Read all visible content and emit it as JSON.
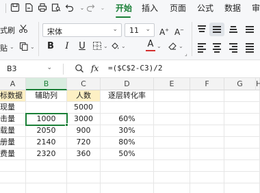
{
  "quick_access": {
    "icons": [
      "save-icon",
      "export-pdf-icon",
      "print-icon",
      "print-preview-icon",
      "undo-icon",
      "redo-icon",
      "more-icon"
    ]
  },
  "tabs": [
    {
      "label": "开始",
      "active": true
    },
    {
      "label": "插入",
      "active": false
    },
    {
      "label": "页面",
      "active": false
    },
    {
      "label": "公式",
      "active": false
    },
    {
      "label": "数据",
      "active": false
    },
    {
      "label": "审",
      "active": false
    }
  ],
  "ribbon": {
    "format_painter_label": "式刷",
    "paste_label": "贴",
    "font_name": "宋体",
    "font_size": "11",
    "font_color_accent": "#d32f2f"
  },
  "formula_bar": {
    "name_box": "B3",
    "fx_label": "fx",
    "formula": "=($C$2-C3)/2"
  },
  "columns": [
    "A",
    "B",
    "C",
    "D",
    "E",
    "F",
    "G",
    "H"
  ],
  "rows": [
    {
      "a": "标数据",
      "b": "辅助列",
      "c": "人数",
      "d": "逐层转化率"
    },
    {
      "a": "现量",
      "b": "",
      "c": "5000",
      "d": ""
    },
    {
      "a": "击量",
      "b": "1000",
      "c": "3000",
      "d": "60%"
    },
    {
      "a": "载量",
      "b": "2050",
      "c": "900",
      "d": "30%"
    },
    {
      "a": "册量",
      "b": "2140",
      "c": "720",
      "d": "80%"
    },
    {
      "a": "费量",
      "b": "2320",
      "c": "360",
      "d": "50%"
    }
  ],
  "colors": {
    "accent": "#1a7f37",
    "header_highlight": "#fdf0c4"
  }
}
